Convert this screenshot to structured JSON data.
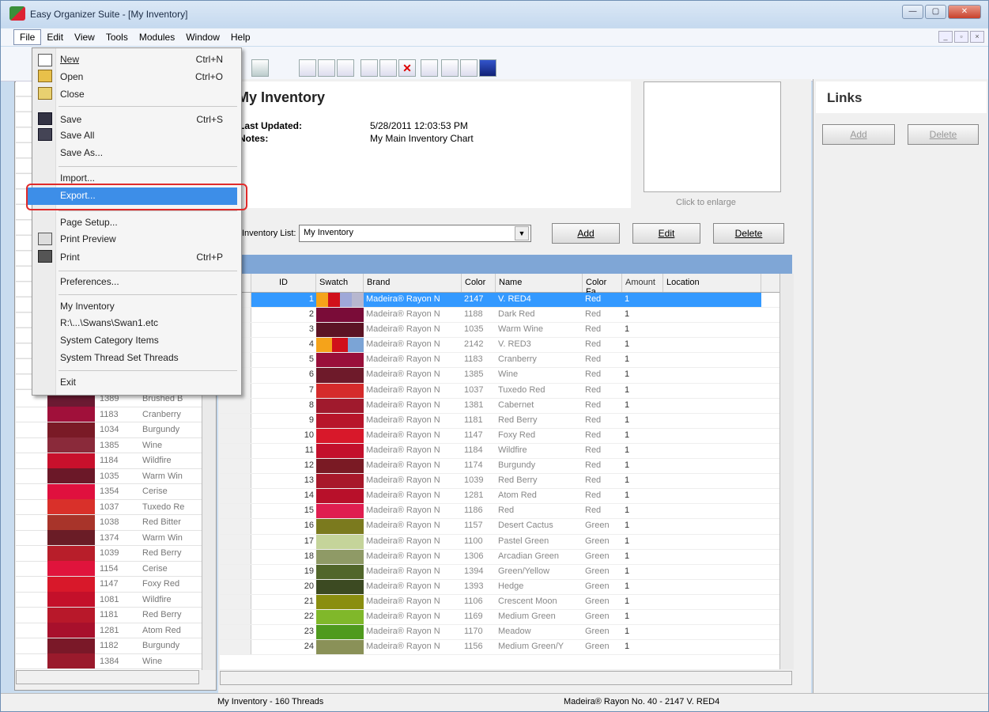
{
  "window": {
    "title": "Easy Organizer Suite - [My Inventory]",
    "min": "—",
    "max": "▢",
    "close": "✕",
    "mdi": [
      "_",
      "▫",
      "×"
    ]
  },
  "menubar": [
    "File",
    "Edit",
    "View",
    "Tools",
    "Modules",
    "Window",
    "Help"
  ],
  "file_menu": {
    "items": [
      {
        "label": "New",
        "shortcut": "Ctrl+N"
      },
      {
        "label": "Open",
        "shortcut": "Ctrl+O"
      },
      {
        "label": "Close",
        "shortcut": ""
      },
      {
        "label": "Save",
        "shortcut": "Ctrl+S"
      },
      {
        "label": "Save All",
        "shortcut": ""
      },
      {
        "label": "Save As...",
        "shortcut": ""
      },
      {
        "label": "Import...",
        "shortcut": ""
      },
      {
        "label": "Export...",
        "shortcut": ""
      },
      {
        "label": "Page Setup...",
        "shortcut": ""
      },
      {
        "label": "Print Preview",
        "shortcut": ""
      },
      {
        "label": "Print",
        "shortcut": "Ctrl+P"
      },
      {
        "label": "Preferences...",
        "shortcut": ""
      },
      {
        "label": "My Inventory",
        "shortcut": ""
      },
      {
        "label": "R:\\...\\Swans\\Swan1.etc",
        "shortcut": ""
      },
      {
        "label": "System Category Items",
        "shortcut": ""
      },
      {
        "label": "System Thread Set Threads",
        "shortcut": ""
      },
      {
        "label": "Exit",
        "shortcut": ""
      }
    ]
  },
  "inventory": {
    "title": "My Inventory",
    "last_updated_label": "Last Updated:",
    "last_updated": "5/28/2011 12:03:53 PM",
    "notes_label": "Notes:",
    "notes": "My Main Inventory Chart",
    "click_to_enlarge": "Click to enlarge",
    "list_label": "Inventory List:",
    "list_value": "My Inventory",
    "add": "Add",
    "edit": "Edit",
    "delete": "Delete"
  },
  "links": {
    "title": "Links",
    "add": "Add",
    "delete": "Delete"
  },
  "grid": {
    "headers": [
      "ID",
      "Swatch",
      "Brand",
      "Color",
      "Name",
      "Color Fa",
      "Amount",
      "Location"
    ],
    "rows": [
      {
        "id": "1",
        "swatch": [
          "#f5a31a",
          "#d0101a",
          "#9fa8d8",
          "#b7b7cf"
        ],
        "brand": "Madeira® Rayon N",
        "color": "2147",
        "name": "V. RED4",
        "fam": "Red",
        "amt": "1",
        "sel": true
      },
      {
        "id": "2",
        "swatch": [
          "#7a0c38"
        ],
        "brand": "Madeira® Rayon N",
        "color": "1188",
        "name": "Dark Red",
        "fam": "Red",
        "amt": "1"
      },
      {
        "id": "3",
        "swatch": [
          "#5c1425"
        ],
        "brand": "Madeira® Rayon N",
        "color": "1035",
        "name": "Warm Wine",
        "fam": "Red",
        "amt": "1"
      },
      {
        "id": "4",
        "swatch": [
          "#f5a31a",
          "#d0101a",
          "#7ba4d6"
        ],
        "brand": "Madeira® Rayon N",
        "color": "2142",
        "name": "V. RED3",
        "fam": "Red",
        "amt": "1"
      },
      {
        "id": "5",
        "swatch": [
          "#990f3a"
        ],
        "brand": "Madeira® Rayon N",
        "color": "1183",
        "name": "Cranberry",
        "fam": "Red",
        "amt": "1"
      },
      {
        "id": "6",
        "swatch": [
          "#6e1a2a"
        ],
        "brand": "Madeira® Rayon N",
        "color": "1385",
        "name": "Wine",
        "fam": "Red",
        "amt": "1"
      },
      {
        "id": "7",
        "swatch": [
          "#d52b2b"
        ],
        "brand": "Madeira® Rayon N",
        "color": "1037",
        "name": "Tuxedo Red",
        "fam": "Red",
        "amt": "1"
      },
      {
        "id": "8",
        "swatch": [
          "#a01a2d"
        ],
        "brand": "Madeira® Rayon N",
        "color": "1381",
        "name": "Cabernet",
        "fam": "Red",
        "amt": "1"
      },
      {
        "id": "9",
        "swatch": [
          "#b8152a"
        ],
        "brand": "Madeira® Rayon N",
        "color": "1181",
        "name": "Red Berry",
        "fam": "Red",
        "amt": "1"
      },
      {
        "id": "10",
        "swatch": [
          "#d8182a"
        ],
        "brand": "Madeira® Rayon N",
        "color": "1147",
        "name": "Foxy Red",
        "fam": "Red",
        "amt": "1"
      },
      {
        "id": "11",
        "swatch": [
          "#c3102c"
        ],
        "brand": "Madeira® Rayon N",
        "color": "1184",
        "name": "Wildfire",
        "fam": "Red",
        "amt": "1"
      },
      {
        "id": "12",
        "swatch": [
          "#7a1a24"
        ],
        "brand": "Madeira® Rayon N",
        "color": "1174",
        "name": "Burgundy",
        "fam": "Red",
        "amt": "1"
      },
      {
        "id": "13",
        "swatch": [
          "#a8182a"
        ],
        "brand": "Madeira® Rayon N",
        "color": "1039",
        "name": "Red Berry",
        "fam": "Red",
        "amt": "1"
      },
      {
        "id": "14",
        "swatch": [
          "#b8102a"
        ],
        "brand": "Madeira® Rayon N",
        "color": "1281",
        "name": "Atom Red",
        "fam": "Red",
        "amt": "1"
      },
      {
        "id": "15",
        "swatch": [
          "#e01e50"
        ],
        "brand": "Madeira® Rayon N",
        "color": "1186",
        "name": "Red",
        "fam": "Red",
        "amt": "1"
      },
      {
        "id": "16",
        "swatch": [
          "#7b7a1e"
        ],
        "brand": "Madeira® Rayon N",
        "color": "1157",
        "name": "Desert Cactus",
        "fam": "Green",
        "amt": "1"
      },
      {
        "id": "17",
        "swatch": [
          "#c5d49a"
        ],
        "brand": "Madeira® Rayon N",
        "color": "1100",
        "name": "Pastel Green",
        "fam": "Green",
        "amt": "1"
      },
      {
        "id": "18",
        "swatch": [
          "#8f9a66"
        ],
        "brand": "Madeira® Rayon N",
        "color": "1306",
        "name": "Arcadian Green",
        "fam": "Green",
        "amt": "1"
      },
      {
        "id": "19",
        "swatch": [
          "#51662a"
        ],
        "brand": "Madeira® Rayon N",
        "color": "1394",
        "name": "Green/Yellow",
        "fam": "Green",
        "amt": "1"
      },
      {
        "id": "20",
        "swatch": [
          "#3c4a22"
        ],
        "brand": "Madeira® Rayon N",
        "color": "1393",
        "name": "Hedge",
        "fam": "Green",
        "amt": "1"
      },
      {
        "id": "21",
        "swatch": [
          "#8a8e10"
        ],
        "brand": "Madeira® Rayon N",
        "color": "1106",
        "name": "Crescent Moon",
        "fam": "Green",
        "amt": "1"
      },
      {
        "id": "22",
        "swatch": [
          "#80b82a"
        ],
        "brand": "Madeira® Rayon N",
        "color": "1169",
        "name": "Medium Green",
        "fam": "Green",
        "amt": "1"
      },
      {
        "id": "23",
        "swatch": [
          "#4f9a1e"
        ],
        "brand": "Madeira® Rayon N",
        "color": "1170",
        "name": "Meadow",
        "fam": "Green",
        "amt": "1"
      },
      {
        "id": "24",
        "swatch": [
          "#8a9158"
        ],
        "brand": "Madeira® Rayon N",
        "color": "1156",
        "name": "Medium Green/Y",
        "fam": "Green",
        "amt": "1"
      }
    ]
  },
  "left_list": [
    {
      "color": "#6b1a32",
      "code": "1389",
      "name": "Brushed B"
    },
    {
      "color": "#a0103a",
      "code": "1183",
      "name": "Cranberry"
    },
    {
      "color": "#7a1a26",
      "code": "1034",
      "name": "Burgundy"
    },
    {
      "color": "#8a2a3a",
      "code": "1385",
      "name": "Wine"
    },
    {
      "color": "#c8102c",
      "code": "1184",
      "name": "Wildfire"
    },
    {
      "color": "#6b1828",
      "code": "1035",
      "name": "Warm Win"
    },
    {
      "color": "#e0103e",
      "code": "1354",
      "name": "Cerise"
    },
    {
      "color": "#d9302a",
      "code": "1037",
      "name": "Tuxedo Re"
    },
    {
      "color": "#a8342a",
      "code": "1038",
      "name": "Red Bitter"
    },
    {
      "color": "#6a1c26",
      "code": "1374",
      "name": "Warm Win"
    },
    {
      "color": "#b81e2a",
      "code": "1039",
      "name": "Red Berry"
    },
    {
      "color": "#e0143c",
      "code": "1154",
      "name": "Cerise"
    },
    {
      "color": "#d8182a",
      "code": "1147",
      "name": "Foxy Red"
    },
    {
      "color": "#c4102a",
      "code": "1081",
      "name": "Wildfire"
    },
    {
      "color": "#b8182a",
      "code": "1181",
      "name": "Red Berry"
    },
    {
      "color": "#a8102c",
      "code": "1281",
      "name": "Atom Red"
    },
    {
      "color": "#7a1828",
      "code": "1182",
      "name": "Burgundy"
    },
    {
      "color": "#9a1a2c",
      "code": "1384",
      "name": "Wine"
    }
  ],
  "status": {
    "left": "My Inventory - 160 Threads",
    "right": "Madeira® Rayon No. 40 - 2147 V. RED4"
  }
}
